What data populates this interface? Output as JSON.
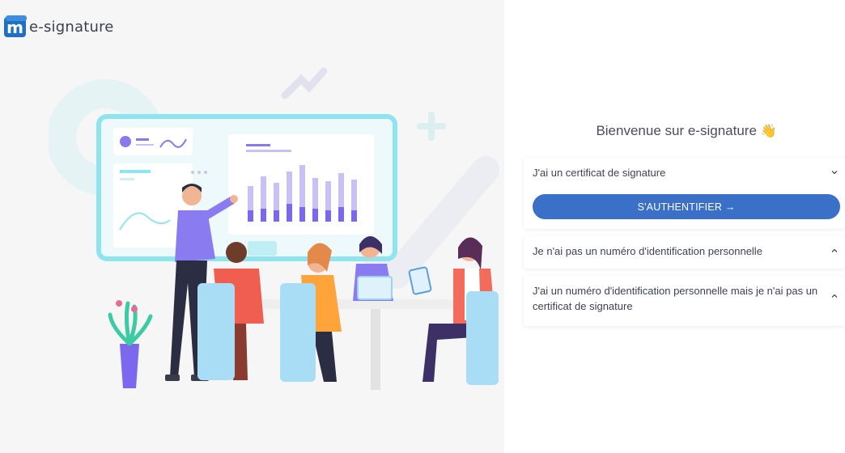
{
  "app": {
    "logo_letter": "m",
    "logo_text": "e-signature"
  },
  "welcome": {
    "title": "Bienvenue sur e-signature",
    "emoji": "👋"
  },
  "accordion": [
    {
      "title": "J'ai un certificat de signature",
      "icon": "chevron-down-icon",
      "expanded": true,
      "button_label": "S'AUTHENTIFIER →"
    },
    {
      "title": "Je n'ai pas un numéro d'identification personnelle",
      "icon": "chevron-up-icon",
      "expanded": false
    },
    {
      "title": "J'ai un numéro d'identification personnelle mais je n'ai pas un certificat de signature",
      "icon": "chevron-up-icon",
      "expanded": false
    }
  ],
  "colors": {
    "primary_button": "#3a70c8",
    "left_background": "#f6f6f7",
    "illustration_accent": "#7b68ee"
  }
}
